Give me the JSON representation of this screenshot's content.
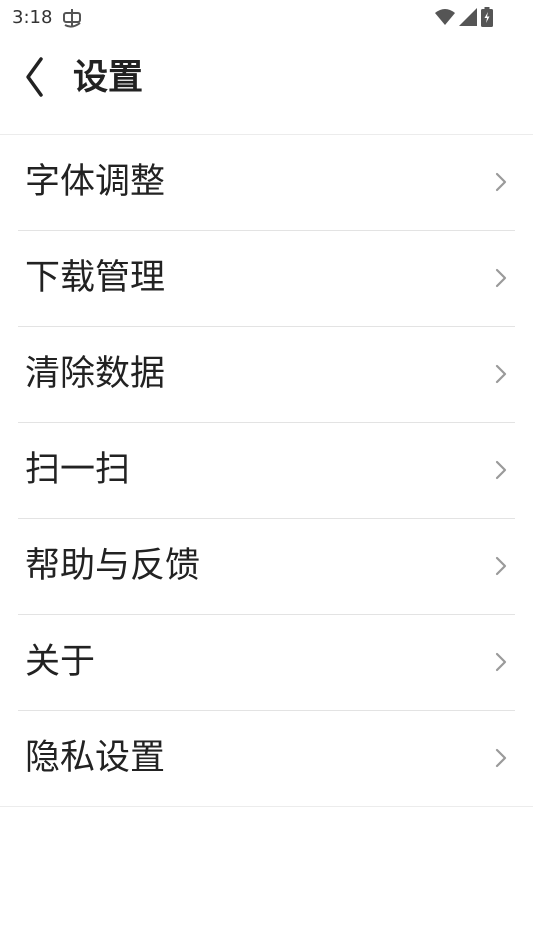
{
  "status_bar": {
    "time": "3:18",
    "app_icon": "app-notification-icon",
    "wifi_icon": "wifi-icon",
    "signal_icon": "cellular-signal-icon",
    "battery_icon": "battery-charging-icon"
  },
  "header": {
    "back_icon": "chevron-left-icon",
    "title": "设置"
  },
  "settings": {
    "items": [
      {
        "label": "字体调整",
        "icon": "chevron-right-icon"
      },
      {
        "label": "下载管理",
        "icon": "chevron-right-icon"
      },
      {
        "label": "清除数据",
        "icon": "chevron-right-icon"
      },
      {
        "label": "扫一扫",
        "icon": "chevron-right-icon"
      },
      {
        "label": "帮助与反馈",
        "icon": "chevron-right-icon"
      },
      {
        "label": "关于",
        "icon": "chevron-right-icon"
      },
      {
        "label": "隐私设置",
        "icon": "chevron-right-icon"
      }
    ]
  },
  "colors": {
    "text": "#222222",
    "divider": "#e3e3e3",
    "chevron": "#9a9a9a",
    "status_icons": "#555555"
  }
}
